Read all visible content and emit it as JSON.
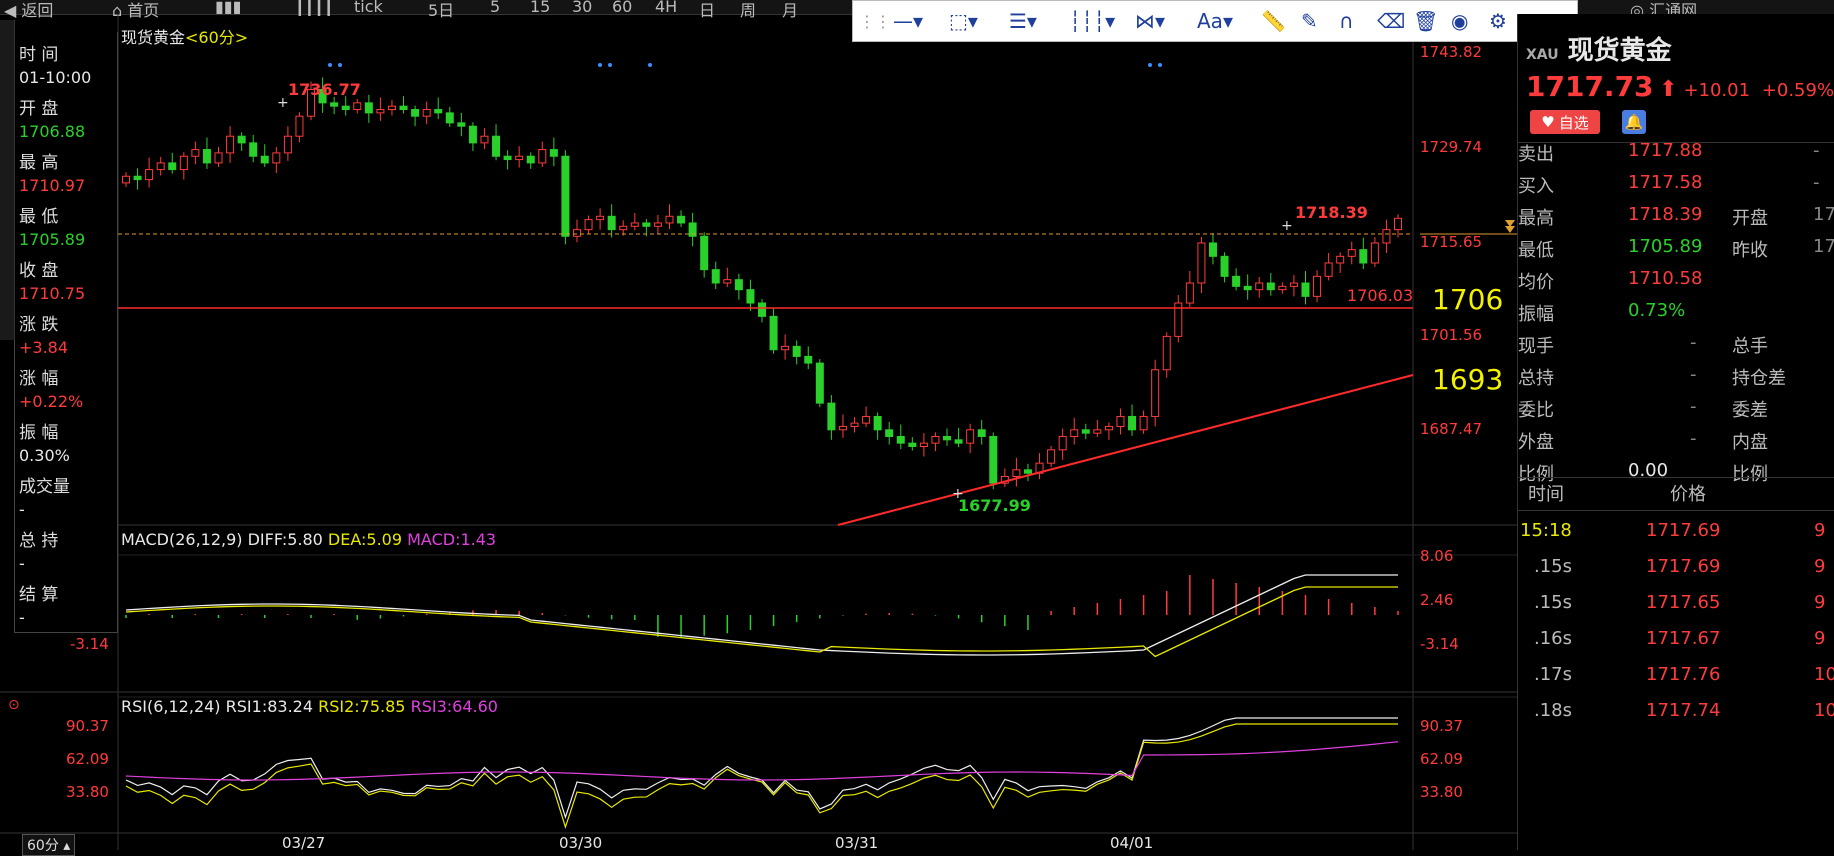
{
  "toolbar": {
    "items": [
      "返回",
      "首页",
      "",
      "tick",
      "5日",
      "5",
      "15",
      "30",
      "60",
      "4H",
      "日",
      "周",
      "月"
    ],
    "broker": "汇通网"
  },
  "drawing_toolbar": {
    "font_label": "Aa"
  },
  "chart": {
    "title": "现货黄金",
    "period": "<60分>",
    "period_footer": "60分",
    "max_label": "1736.77",
    "min_label": "1677.99",
    "last_high_label": "1718.39",
    "hline_label": "1706.03",
    "annot_1706": "1706",
    "annot_1693": "1693",
    "price_ticks": [
      "1743.82",
      "1729.74",
      "1715.65",
      "1701.56",
      "1687.47"
    ],
    "date_ticks": [
      "03/27",
      "03/30",
      "03/31",
      "04/01"
    ]
  },
  "macd": {
    "title": "MACD(26,12,9)",
    "diff": "DIFF:5.80",
    "dea": "DEA:5.09",
    "macd": "MACD:1.43",
    "ticks": [
      "8.06",
      "2.46",
      "-3.14"
    ],
    "left_tick": "-3.14"
  },
  "rsi": {
    "title": "RSI(6,12,24)",
    "rsi1": "RSI1:83.24",
    "rsi2": "RSI2:75.85",
    "rsi3": "RSI3:64.60",
    "ticks": [
      "90.37",
      "62.09",
      "33.80"
    ]
  },
  "left_panel": {
    "time_label": "时 间",
    "time_value": "01-10:00",
    "open_label": "开 盘",
    "open_value": "1706.88",
    "high_label": "最 高",
    "high_value": "1710.97",
    "low_label": "最 低",
    "low_value": "1705.89",
    "close_label": "收 盘",
    "close_value": "1710.75",
    "change_label": "涨 跌",
    "change_value": "+3.84",
    "pct_label": "涨 幅",
    "pct_value": "+0.22%",
    "amp_label": "振 幅",
    "amp_value": "0.30%",
    "vol_label": "成交量",
    "vol_value": "-",
    "hold_label": "总 持",
    "hold_value": "-",
    "settle_label": "结 算",
    "settle_value": "-"
  },
  "quote": {
    "name_prefix": "XAU",
    "name": "现货黄金",
    "price": "1717.73",
    "change": "+10.01",
    "pct": "+0.59%",
    "fav_label": "自选",
    "rows": [
      {
        "l1": "卖出",
        "v1": "1717.88",
        "l2": "",
        "v2": "-"
      },
      {
        "l1": "买入",
        "v1": "1717.58",
        "l2": "",
        "v2": "-"
      },
      {
        "l1": "最高",
        "v1": "1718.39",
        "l2": "开盘",
        "v2": "17"
      },
      {
        "l1": "最低",
        "v1": "1705.89",
        "l2": "昨收",
        "v2": "17"
      },
      {
        "l1": "均价",
        "v1": "1710.58",
        "l2": "",
        "v2": ""
      },
      {
        "l1": "振幅",
        "v1": "0.73%",
        "l2": "",
        "v2": ""
      },
      {
        "l1": "现手",
        "v1": "-",
        "l2": "总手",
        "v2": ""
      },
      {
        "l1": "总持",
        "v1": "-",
        "l2": "持仓差",
        "v2": ""
      },
      {
        "l1": "委比",
        "v1": "-",
        "l2": "委差",
        "v2": ""
      },
      {
        "l1": "外盘",
        "v1": "-",
        "l2": "内盘",
        "v2": ""
      },
      {
        "l1": "比例",
        "v1": "0.00",
        "l2": "比例",
        "v2": ""
      }
    ],
    "ticks_header": {
      "time": "时间",
      "price": "价格"
    },
    "ticks": [
      {
        "time": "15:18",
        "price": "1717.69",
        "extra": "9"
      },
      {
        "time": ".15s",
        "price": "1717.69",
        "extra": "9"
      },
      {
        "time": ".15s",
        "price": "1717.65",
        "extra": "9"
      },
      {
        "time": ".16s",
        "price": "1717.67",
        "extra": "9"
      },
      {
        "time": ".17s",
        "price": "1717.76",
        "extra": "10"
      },
      {
        "time": ".18s",
        "price": "1717.74",
        "extra": "10"
      }
    ]
  },
  "colors": {
    "up": "#ff3b3b",
    "down": "#2ad12a",
    "bg": "#000000",
    "accent": "#1f3f9c"
  }
}
